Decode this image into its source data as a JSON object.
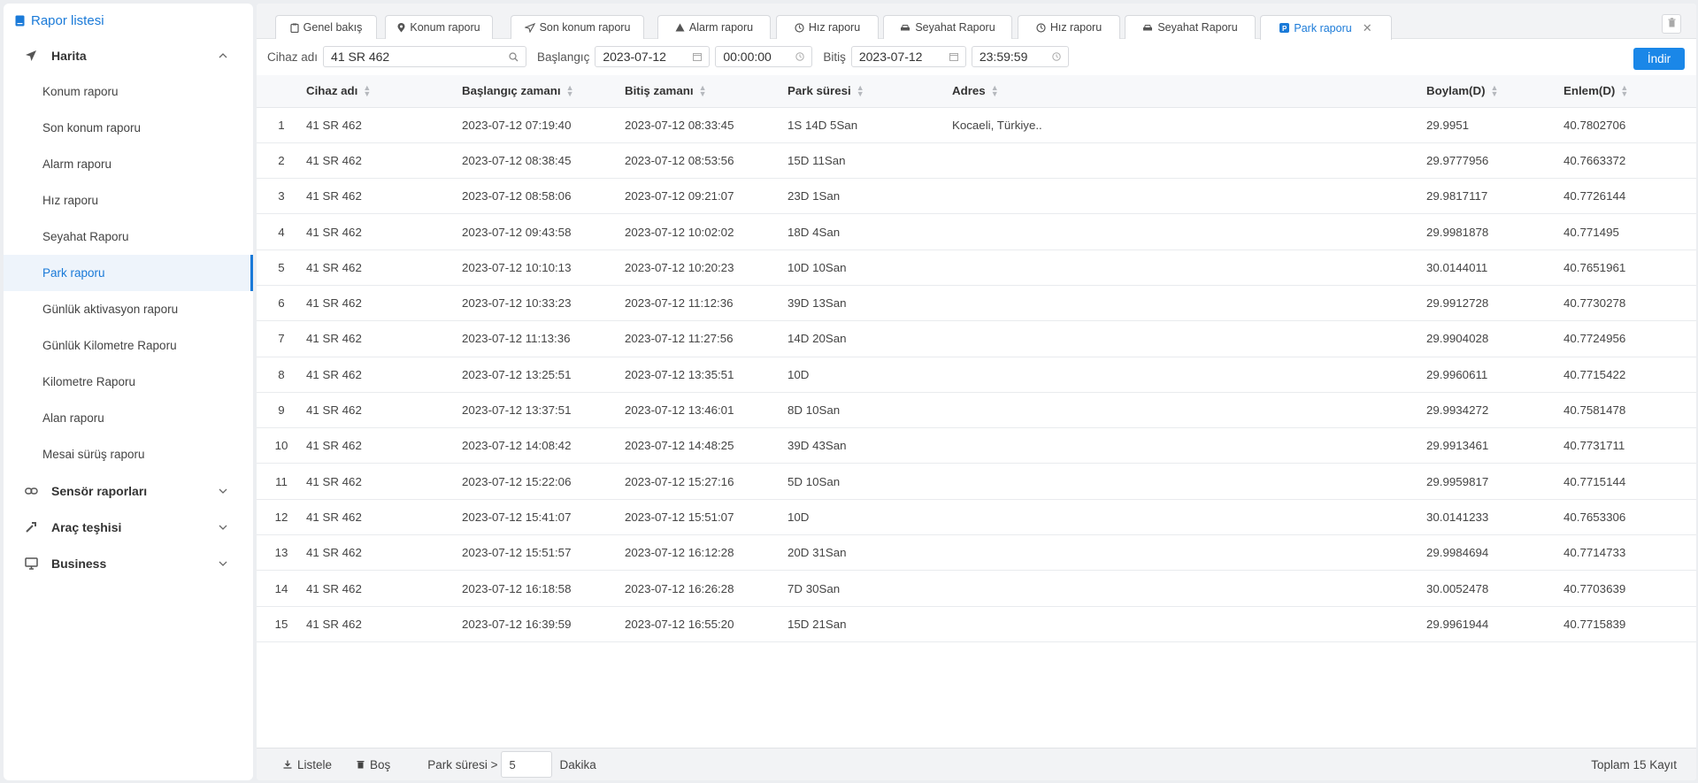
{
  "sidebar": {
    "title": "Rapor listesi",
    "groups": [
      {
        "label": "Harita",
        "expanded": true
      },
      {
        "label": "Sensör raporları"
      },
      {
        "label": "Araç teşhisi"
      },
      {
        "label": "Business"
      }
    ],
    "items": [
      {
        "label": "Konum raporu"
      },
      {
        "label": "Son konum raporu"
      },
      {
        "label": "Alarm raporu"
      },
      {
        "label": "Hız raporu"
      },
      {
        "label": "Seyahat Raporu"
      },
      {
        "label": "Park raporu",
        "active": true
      },
      {
        "label": "Günlük aktivasyon raporu"
      },
      {
        "label": "Günlük Kilometre Raporu"
      },
      {
        "label": "Kilometre Raporu"
      },
      {
        "label": "Alan raporu"
      },
      {
        "label": "Mesai sürüş raporu"
      }
    ]
  },
  "tabs": [
    {
      "label": "Genel bakış",
      "icon": "clipboard-icon"
    },
    {
      "label": "Konum raporu",
      "icon": "pin-icon"
    },
    {
      "label": "Son konum raporu",
      "icon": "send-icon"
    },
    {
      "label": "Alarm raporu",
      "icon": "warning-icon"
    },
    {
      "label": "Hız raporu",
      "icon": "speed-icon"
    },
    {
      "label": "Seyahat Raporu",
      "icon": "car-icon"
    },
    {
      "label": "Hız raporu",
      "icon": "speed-icon"
    },
    {
      "label": "Seyahat Raporu",
      "icon": "car-icon"
    },
    {
      "label": "Park raporu",
      "icon": "parking-icon",
      "active": true
    }
  ],
  "filter": {
    "device_label": "Cihaz adı",
    "device_value": "41 SR 462",
    "start_label": "Başlangıç",
    "start_date": "2023-07-12",
    "start_time": "00:00:00",
    "end_label": "Bitiş",
    "end_date": "2023-07-12",
    "end_time": "23:59:59",
    "download_label": "İndir"
  },
  "table": {
    "headers": {
      "device": "Cihaz adı",
      "start": "Başlangıç zamanı",
      "end": "Bitiş zamanı",
      "duration": "Park süresi",
      "address": "Adres",
      "lon": "Boylam(D)",
      "lat": "Enlem(D)"
    },
    "rows": [
      {
        "idx": "1",
        "device": "41 SR 462",
        "start": "2023-07-12 07:19:40",
        "end": "2023-07-12 08:33:45",
        "duration": "1S 14D 5San",
        "address": "Kocaeli, Türkiye..",
        "lon": "29.9951",
        "lat": "40.7802706"
      },
      {
        "idx": "2",
        "device": "41 SR 462",
        "start": "2023-07-12 08:38:45",
        "end": "2023-07-12 08:53:56",
        "duration": "15D 11San",
        "address": "",
        "lon": "29.9777956",
        "lat": "40.7663372"
      },
      {
        "idx": "3",
        "device": "41 SR 462",
        "start": "2023-07-12 08:58:06",
        "end": "2023-07-12 09:21:07",
        "duration": "23D 1San",
        "address": "",
        "lon": "29.9817117",
        "lat": "40.7726144"
      },
      {
        "idx": "4",
        "device": "41 SR 462",
        "start": "2023-07-12 09:43:58",
        "end": "2023-07-12 10:02:02",
        "duration": "18D 4San",
        "address": "",
        "lon": "29.9981878",
        "lat": "40.771495"
      },
      {
        "idx": "5",
        "device": "41 SR 462",
        "start": "2023-07-12 10:10:13",
        "end": "2023-07-12 10:20:23",
        "duration": "10D 10San",
        "address": "",
        "lon": "30.0144011",
        "lat": "40.7651961"
      },
      {
        "idx": "6",
        "device": "41 SR 462",
        "start": "2023-07-12 10:33:23",
        "end": "2023-07-12 11:12:36",
        "duration": "39D 13San",
        "address": "",
        "lon": "29.9912728",
        "lat": "40.7730278"
      },
      {
        "idx": "7",
        "device": "41 SR 462",
        "start": "2023-07-12 11:13:36",
        "end": "2023-07-12 11:27:56",
        "duration": "14D 20San",
        "address": "",
        "lon": "29.9904028",
        "lat": "40.7724956"
      },
      {
        "idx": "8",
        "device": "41 SR 462",
        "start": "2023-07-12 13:25:51",
        "end": "2023-07-12 13:35:51",
        "duration": "10D",
        "address": "",
        "lon": "29.9960611",
        "lat": "40.7715422"
      },
      {
        "idx": "9",
        "device": "41 SR 462",
        "start": "2023-07-12 13:37:51",
        "end": "2023-07-12 13:46:01",
        "duration": "8D 10San",
        "address": "",
        "lon": "29.9934272",
        "lat": "40.7581478"
      },
      {
        "idx": "10",
        "device": "41 SR 462",
        "start": "2023-07-12 14:08:42",
        "end": "2023-07-12 14:48:25",
        "duration": "39D 43San",
        "address": "",
        "lon": "29.9913461",
        "lat": "40.7731711"
      },
      {
        "idx": "11",
        "device": "41 SR 462",
        "start": "2023-07-12 15:22:06",
        "end": "2023-07-12 15:27:16",
        "duration": "5D 10San",
        "address": "",
        "lon": "29.9959817",
        "lat": "40.7715144"
      },
      {
        "idx": "12",
        "device": "41 SR 462",
        "start": "2023-07-12 15:41:07",
        "end": "2023-07-12 15:51:07",
        "duration": "10D",
        "address": "",
        "lon": "30.0141233",
        "lat": "40.7653306"
      },
      {
        "idx": "13",
        "device": "41 SR 462",
        "start": "2023-07-12 15:51:57",
        "end": "2023-07-12 16:12:28",
        "duration": "20D 31San",
        "address": "",
        "lon": "29.9984694",
        "lat": "40.7714733"
      },
      {
        "idx": "14",
        "device": "41 SR 462",
        "start": "2023-07-12 16:18:58",
        "end": "2023-07-12 16:26:28",
        "duration": "7D 30San",
        "address": "",
        "lon": "30.0052478",
        "lat": "40.7703639"
      },
      {
        "idx": "15",
        "device": "41 SR 462",
        "start": "2023-07-12 16:39:59",
        "end": "2023-07-12 16:55:20",
        "duration": "15D 21San",
        "address": "",
        "lon": "29.9961944",
        "lat": "40.7715839"
      }
    ]
  },
  "footer": {
    "list_label": "Listele",
    "empty_label": "Boş",
    "park_label": "Park süresi >",
    "park_value": "5",
    "unit_label": "Dakika",
    "total_label": "Toplam 15 Kayıt"
  },
  "colors": {
    "accent": "#1a7ad8",
    "button": "#1a87e8"
  }
}
